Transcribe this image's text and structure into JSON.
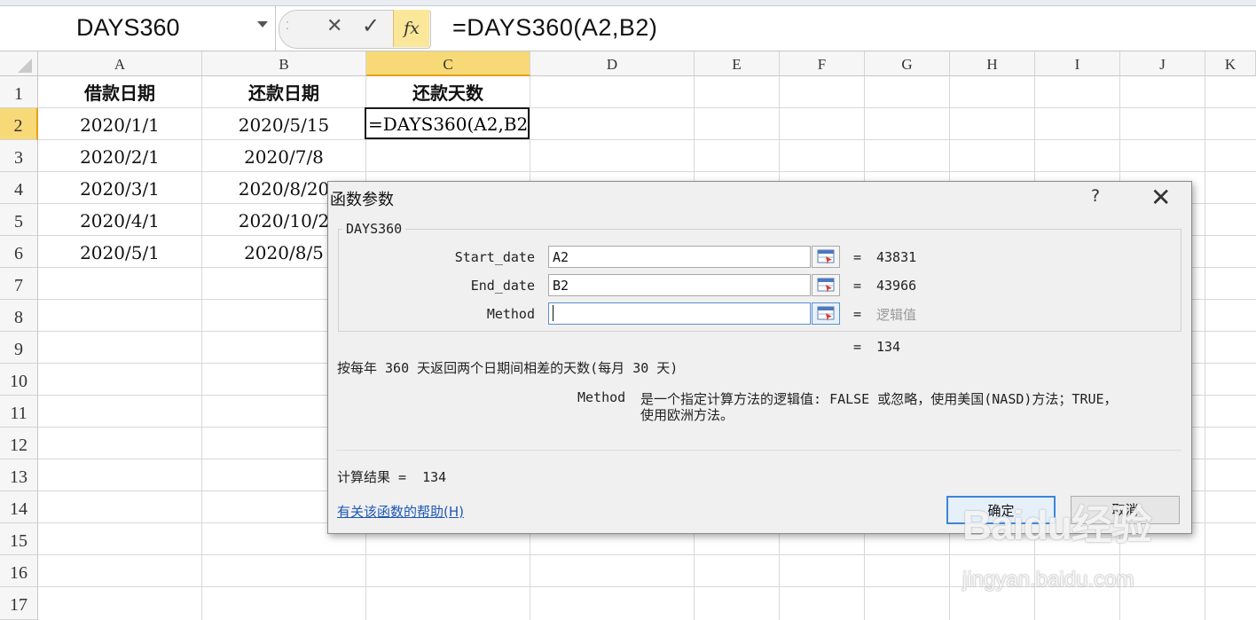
{
  "formula_bar": {
    "name_box": "DAYS360",
    "cancel_glyph": "✕",
    "enter_glyph": "✓",
    "fx_label": "fx",
    "formula": "=DAYS360(A2,B2)"
  },
  "columns": [
    "A",
    "B",
    "C",
    "D",
    "E",
    "F",
    "G",
    "H",
    "I",
    "J",
    "K"
  ],
  "rows": [
    "1",
    "2",
    "3",
    "4",
    "5",
    "6",
    "7",
    "8",
    "9",
    "10",
    "11",
    "12",
    "13",
    "14",
    "15",
    "16",
    "17"
  ],
  "cells": {
    "A1": "借款日期",
    "B1": "还款日期",
    "C1": "还款天数",
    "A2": "2020/1/1",
    "B2": "2020/5/15",
    "A3": "2020/2/1",
    "B3": "2020/7/8",
    "A4": "2020/3/1",
    "B4": "2020/8/20",
    "A5": "2020/4/1",
    "B5": "2020/10/2",
    "A6": "2020/5/1",
    "B6": "2020/8/5"
  },
  "active_cell": {
    "ref": "C2",
    "content": "=DAYS360(A2,B2)"
  },
  "dialog": {
    "title": "函数参数",
    "help_glyph": "?",
    "close_glyph": "✕",
    "function_name": "DAYS360",
    "args": [
      {
        "label": "Start_date",
        "value": "A2",
        "result": "43831",
        "eq": "="
      },
      {
        "label": "End_date",
        "value": "B2",
        "result": "43966",
        "eq": "="
      },
      {
        "label": "Method",
        "value": "",
        "result": "逻辑值",
        "eq": "="
      }
    ],
    "function_result_eq": "=",
    "function_result": "134",
    "description": "按每年 360 天返回两个日期间相差的天数(每月 30 天)",
    "param_name": "Method",
    "param_desc_line1": "是一个指定计算方法的逻辑值: FALSE 或忽略，使用美国(NASD)方法；TRUE，",
    "param_desc_line2": "使用欧洲方法。",
    "calc_result_label": "计算结果 =  134",
    "help_link": "有关该函数的帮助(H)",
    "ok_label": "确定",
    "cancel_label": "取消"
  },
  "watermark": {
    "main": "Baidu经验",
    "sub": "jingyan.baidu.com"
  }
}
